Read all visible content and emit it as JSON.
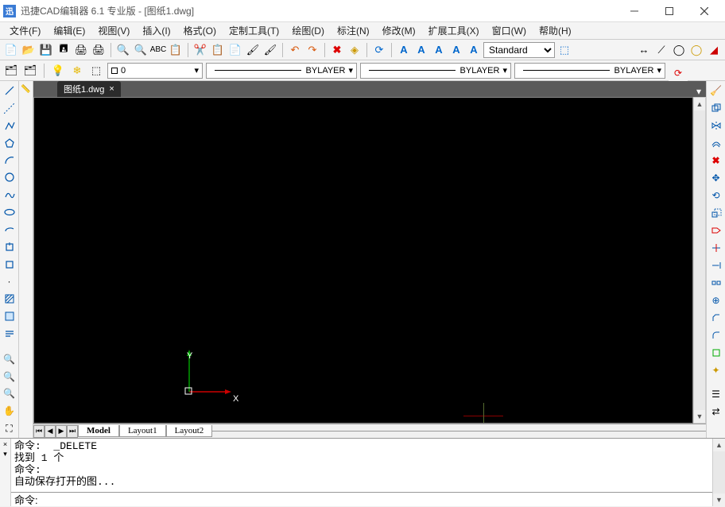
{
  "titlebar": {
    "app_glyph": "迅",
    "title": "迅捷CAD编辑器 6.1 专业版  - [图纸1.dwg]"
  },
  "menu": {
    "items": [
      "文件(F)",
      "编辑(E)",
      "视图(V)",
      "插入(I)",
      "格式(O)",
      "定制工具(T)",
      "绘图(D)",
      "标注(N)",
      "修改(M)",
      "扩展工具(X)",
      "窗口(W)",
      "帮助(H)"
    ]
  },
  "toolbar1": {
    "style_drop": "Standard"
  },
  "toolbar2": {
    "layer_value": "0",
    "combo1": "BYLAYER",
    "combo2": "BYLAYER",
    "combo3": "BYLAYER"
  },
  "file_tab": {
    "label": "图纸1.dwg"
  },
  "ucs": {
    "x": "X",
    "y": "Y"
  },
  "layout_tabs": {
    "model": "Model",
    "layout1": "Layout1",
    "layout2": "Layout2"
  },
  "cmd": {
    "history": "命令:  _DELETE\n找到 1 个\n命令:\n自动保存打开的图...",
    "prompt": "命令:",
    "value": ""
  }
}
